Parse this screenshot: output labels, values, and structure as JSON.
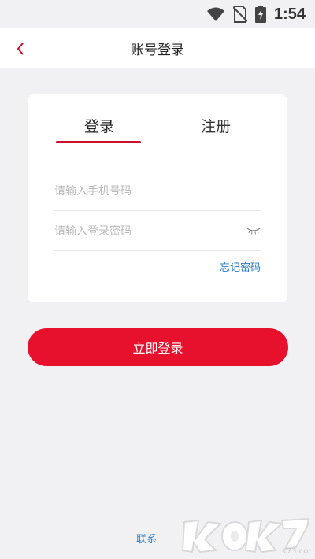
{
  "status_bar": {
    "time": "1:54"
  },
  "nav": {
    "title": "账号登录"
  },
  "tabs": [
    {
      "label": "登录",
      "active": true
    },
    {
      "label": "注册",
      "active": false
    }
  ],
  "form": {
    "phone_placeholder": "请输入手机号码",
    "password_placeholder": "请输入登录密码",
    "forgot_password": "忘记密码"
  },
  "actions": {
    "login_button": "立即登录"
  },
  "footer": {
    "contact_link": "联系"
  },
  "watermark": {
    "text": "k73.com"
  },
  "colors": {
    "accent": "#e7102d",
    "link": "#2a7dcf",
    "background": "#f1f1f3"
  }
}
